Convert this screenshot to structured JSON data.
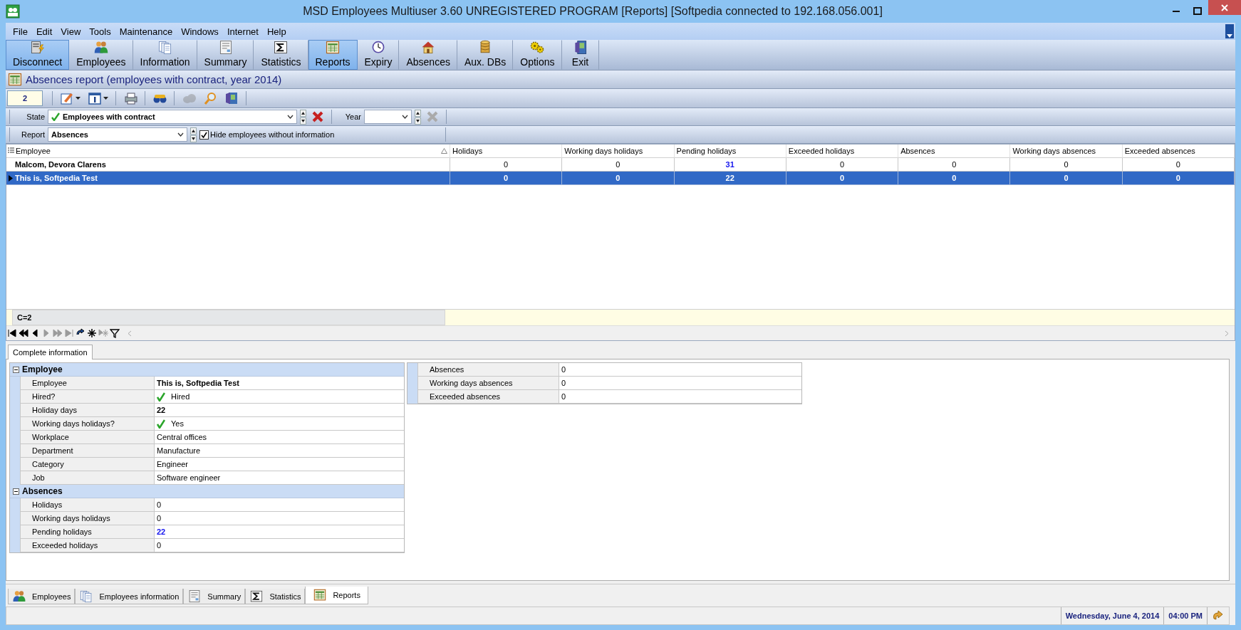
{
  "window": {
    "title": "MSD Employees Multiuser 3.60 UNREGISTERED PROGRAM [Reports] [Softpedia connected to 192.168.056.001]"
  },
  "menu": [
    "File",
    "Edit",
    "View",
    "Tools",
    "Maintenance",
    "Windows",
    "Internet",
    "Help"
  ],
  "toolbar": [
    {
      "label": "Disconnect",
      "selected": true
    },
    {
      "label": "Employees",
      "selected": false
    },
    {
      "label": "Information",
      "selected": false
    },
    {
      "label": "Summary",
      "selected": false
    },
    {
      "label": "Statistics",
      "selected": false
    },
    {
      "label": "Reports",
      "selected": true
    },
    {
      "label": "Expiry",
      "selected": false
    },
    {
      "label": "Absences",
      "selected": false
    },
    {
      "label": "Aux. DBs",
      "selected": false
    },
    {
      "label": "Options",
      "selected": false
    },
    {
      "label": "Exit",
      "selected": false
    }
  ],
  "report_title": "Absences report (employees with contract, year 2014)",
  "record_field": {
    "value": "2"
  },
  "small_toolbar": [
    {
      "disabled": false
    },
    {
      "disabled": false
    },
    {
      "disabled": false
    },
    {
      "disabled": false
    },
    {
      "disabled": true
    },
    {
      "disabled": false
    },
    {
      "disabled": false
    }
  ],
  "state": {
    "label": "State",
    "value": "Employees with contract",
    "clear": {
      "disabled": false
    }
  },
  "year": {
    "label": "Year",
    "clear": {
      "disabled": true
    }
  },
  "report": {
    "label": "Report",
    "value": "Absences"
  },
  "hide_empty": {
    "label": "Hide employees without information",
    "checked": true
  },
  "table": {
    "columns": [
      {
        "label": "Employee",
        "kind": "name",
        "sorted": true
      },
      {
        "label": "Holidays",
        "kind": "number",
        "sorted": false
      },
      {
        "label": "Working days holidays",
        "kind": "number",
        "sorted": false
      },
      {
        "label": "Pending holidays",
        "kind": "accent",
        "sorted": false
      },
      {
        "label": "Exceeded holidays",
        "kind": "number",
        "sorted": false
      },
      {
        "label": "Absences",
        "kind": "number",
        "sorted": false
      },
      {
        "label": "Working days absences",
        "kind": "number",
        "sorted": false
      },
      {
        "label": "Exceeded absences",
        "kind": "number",
        "sorted": false
      }
    ],
    "rows": [
      {
        "cells": [
          "Malcom, Devora Clarens",
          "0",
          "0",
          "31",
          "0",
          "0",
          "0",
          "0"
        ],
        "selected": false
      },
      {
        "cells": [
          "This is, Softpedia Test",
          "0",
          "0",
          "22",
          "0",
          "0",
          "0",
          "0"
        ],
        "selected": true
      }
    ],
    "footer": "C=2"
  },
  "navigator": [
    {
      "disabled": false
    },
    {
      "disabled": false
    },
    {
      "disabled": false
    },
    {
      "disabled": true
    },
    {
      "disabled": true
    },
    {
      "disabled": true
    },
    {
      "disabled": false
    },
    {
      "disabled": false
    },
    {
      "disabled": true
    },
    {
      "disabled": false
    }
  ],
  "detail_tabs": [
    {
      "label": "Complete information",
      "selected": true
    }
  ],
  "groups": [
    {
      "title": "Employee",
      "expanded": true,
      "rows": [
        {
          "label": "Employee",
          "value": "This is, Softpedia Test",
          "kind": "bold"
        },
        {
          "label": "Hired?",
          "value": "Hired",
          "kind": "check"
        },
        {
          "label": "Holiday days",
          "value": "22",
          "kind": "bold"
        },
        {
          "label": "Working days holidays?",
          "value": "Yes",
          "kind": "check"
        },
        {
          "label": "Workplace",
          "value": "Central offices",
          "kind": "plain"
        },
        {
          "label": "Department",
          "value": "Manufacture",
          "kind": "plain"
        },
        {
          "label": "Category",
          "value": "Engineer",
          "kind": "plain"
        },
        {
          "label": "Job",
          "value": "Software engineer",
          "kind": "plain"
        }
      ]
    },
    {
      "title": "Absences",
      "expanded": true,
      "rows": [
        {
          "label": "Holidays",
          "value": "0",
          "kind": "plain"
        },
        {
          "label": "Working days holidays",
          "value": "0",
          "kind": "plain"
        },
        {
          "label": "Pending holidays",
          "value": "22",
          "kind": "accent"
        },
        {
          "label": "Exceeded holidays",
          "value": "0",
          "kind": "plain"
        }
      ]
    }
  ],
  "extra_rows": [
    {
      "label": "Absences",
      "value": "0"
    },
    {
      "label": "Working days absences",
      "value": "0"
    },
    {
      "label": "Exceeded absences",
      "value": "0"
    }
  ],
  "bottom_tabs": [
    {
      "label": "Employees",
      "selected": false
    },
    {
      "label": "Employees information",
      "selected": false
    },
    {
      "label": "Summary",
      "selected": false
    },
    {
      "label": "Statistics",
      "selected": false
    },
    {
      "label": "Reports",
      "selected": true
    }
  ],
  "status_bar": {
    "date": "Wednesday, June 4, 2014",
    "time": "04:00 PM"
  }
}
